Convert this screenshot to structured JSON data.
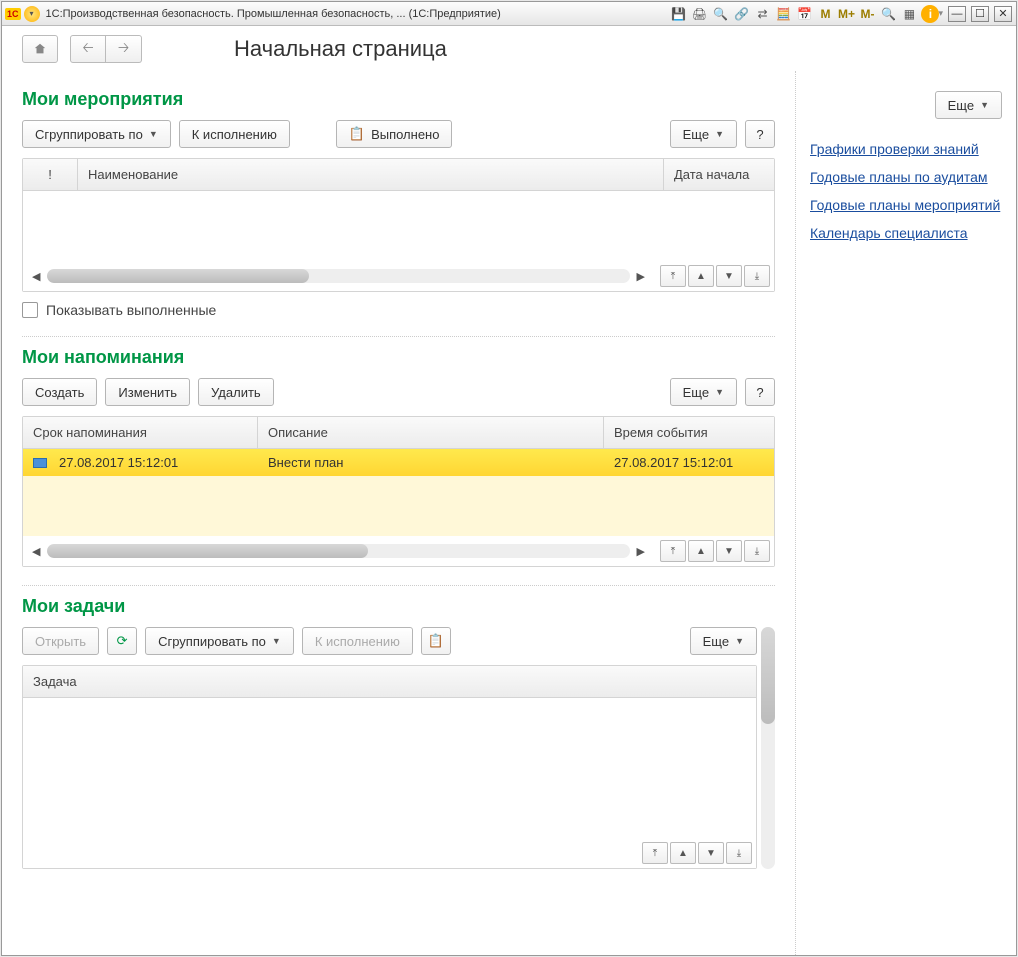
{
  "titlebar": {
    "app_icon_text": "1C",
    "title": "1С:Производственная безопасность. Промышленная безопасность, ... (1С:Предприятие)",
    "m_labels": [
      "M",
      "M+",
      "M-"
    ]
  },
  "nav": {
    "page_title": "Начальная страница"
  },
  "events": {
    "heading": "Мои мероприятия",
    "group_by": "Сгруппировать по",
    "to_execution": "К исполнению",
    "done": "Выполнено",
    "more": "Еще",
    "help": "?",
    "columns": {
      "icon": "!",
      "name": "Наименование",
      "start": "Дата начала"
    },
    "show_done": "Показывать выполненные"
  },
  "reminders": {
    "heading": "Мои напоминания",
    "create": "Создать",
    "edit": "Изменить",
    "delete": "Удалить",
    "more": "Еще",
    "help": "?",
    "columns": {
      "deadline": "Срок напоминания",
      "desc": "Описание",
      "event_time": "Время события"
    },
    "rows": [
      {
        "deadline": "27.08.2017 15:12:01",
        "desc": "Внести план",
        "event_time": "27.08.2017 15:12:01"
      }
    ]
  },
  "tasks": {
    "heading": "Мои задачи",
    "open": "Открыть",
    "group_by": "Сгруппировать по",
    "to_execution": "К исполнению",
    "more": "Еще",
    "columns": {
      "task": "Задача"
    }
  },
  "side": {
    "more": "Еще",
    "links": [
      "Графики проверки знаний",
      "Годовые планы по аудитам",
      "Годовые планы мероприятий",
      "Календарь специалиста"
    ]
  }
}
